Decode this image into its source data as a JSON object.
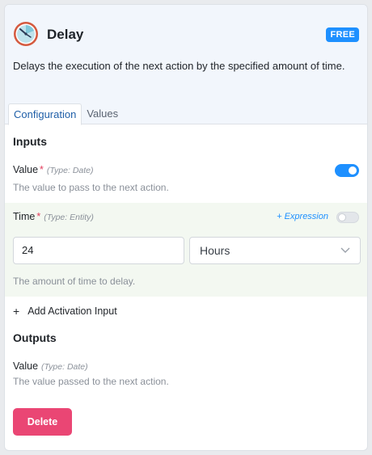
{
  "header": {
    "title": "Delay",
    "badge": "FREE",
    "description": "Delays the execution of the next action by the specified amount of time.",
    "logo_icon": "clock-icon"
  },
  "tabs": [
    {
      "label": "Configuration",
      "active": true
    },
    {
      "label": "Values",
      "active": false
    }
  ],
  "inputs": {
    "section_title": "Inputs",
    "value_field": {
      "label": "Value",
      "required_mark": "*",
      "type_hint": "(Type: Date)",
      "help": "The value to pass to the next action.",
      "toggle_on": true
    },
    "time_field": {
      "label": "Time",
      "required_mark": "*",
      "type_hint": "(Type: Entity)",
      "expression_label": "+ Expression",
      "expression_enabled": false,
      "amount_value": "24",
      "unit_selected": "Hours",
      "help": "The amount of time to delay."
    },
    "add_activation_label": "Add Activation Input"
  },
  "outputs": {
    "section_title": "Outputs",
    "value_field": {
      "label": "Value",
      "type_hint": "(Type: Date)",
      "help": "The value passed to the next action."
    }
  },
  "actions": {
    "delete_label": "Delete"
  },
  "colors": {
    "accent": "#1e90ff",
    "danger": "#ea4674",
    "header_bg": "#f2f6fc",
    "time_bg": "#f3f8f1"
  }
}
